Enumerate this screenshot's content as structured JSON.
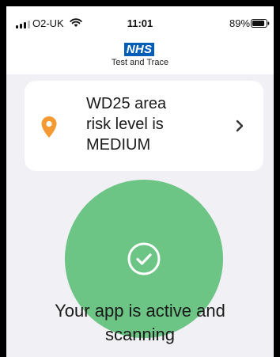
{
  "status_bar": {
    "carrier": "O2-UK",
    "time": "11:01",
    "battery": "89%",
    "battery_level": 0.89
  },
  "header": {
    "logo_text": "NHS",
    "subtitle": "Test and Trace"
  },
  "risk_card": {
    "line1": "WD25 area",
    "line2": "risk level is",
    "line3": "MEDIUM",
    "pin_icon": "map-pin-icon",
    "chevron_icon": "chevron-right-icon"
  },
  "status": {
    "line1": "Your app is active and",
    "line2": "scanning",
    "icon": "check-circle-icon"
  },
  "colors": {
    "nhs_blue": "#005eb8",
    "pin_orange": "#f39a32",
    "active_green": "#6cc485",
    "background": "#f0f0f5"
  }
}
